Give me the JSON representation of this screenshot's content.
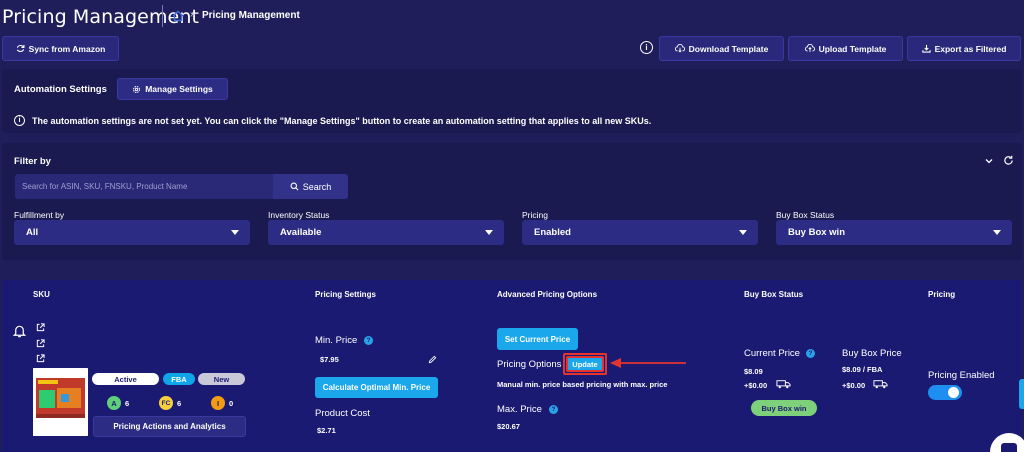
{
  "header": {
    "title": "Pricing Management",
    "breadcrumb_sep": "»",
    "breadcrumb_current": "Pricing Management"
  },
  "toolbar": {
    "sync_label": "Sync from Amazon",
    "info_glyph": "i",
    "download_label": "Download Template",
    "upload_label": "Upload Template",
    "export_label": "Export as Filtered"
  },
  "automation": {
    "label": "Automation Settings",
    "manage_label": "Manage Settings",
    "notice_glyph": "i",
    "notice": "The automation settings are not set yet. You can click the \"Manage Settings\" button to create an automation setting that applies to all new SKUs."
  },
  "filter": {
    "title": "Filter by",
    "search_placeholder": "Search for ASIN, SKU, FNSKU, Product Name",
    "search_label": "Search",
    "fields": [
      {
        "label": "Fulfillment by",
        "value": "All"
      },
      {
        "label": "Inventory Status",
        "value": "Available"
      },
      {
        "label": "Pricing",
        "value": "Enabled"
      },
      {
        "label": "Buy Box Status",
        "value": "Buy Box win"
      }
    ]
  },
  "table": {
    "headers": {
      "sku": "SKU",
      "pricing_settings": "Pricing Settings",
      "advanced": "Advanced Pricing Options",
      "buybox": "Buy Box Status",
      "pricing": "Pricing"
    },
    "row": {
      "badges": {
        "active": "Active",
        "fba": "FBA",
        "new": "New"
      },
      "scores": [
        {
          "letter": "A",
          "count": "6",
          "color": "#5fcf7a"
        },
        {
          "letter": "FC",
          "count": "6",
          "color": "#f4d03f"
        },
        {
          "letter": "I",
          "count": "0",
          "color": "#f39c12"
        }
      ],
      "actions_label": "Pricing Actions and Analytics",
      "min_price_label": "Min. Price",
      "min_price_value": "$7.95",
      "calc_label": "Calculate Optimal Min. Price",
      "product_cost_label": "Product Cost",
      "product_cost_value": "$2.71",
      "set_price_label": "Set Current Price",
      "pricing_options_label": "Pricing Options",
      "update_label": "Update",
      "pricing_desc": "Manual min. price based pricing with max. price",
      "max_price_label": "Max. Price",
      "max_price_value": "$20.67",
      "current_price_label": "Current Price",
      "current_price_value": "$8.09",
      "current_shipping": "+$0.00",
      "buybox_price_label": "Buy Box Price",
      "buybox_price_value": "$8.09 / FBA",
      "buybox_shipping": "+$0.00",
      "buybox_win_label": "Buy Box win",
      "pricing_enabled_label": "Pricing Enabled",
      "pricing_enabled": true,
      "help_glyph": "?"
    }
  },
  "colors": {
    "background": "#1f1e5a",
    "panel": "#1a1950",
    "table": "#1b1a73",
    "accent": "#1aa7ec",
    "highlight": "#e3342f",
    "buybox_win": "#7fd07a"
  }
}
